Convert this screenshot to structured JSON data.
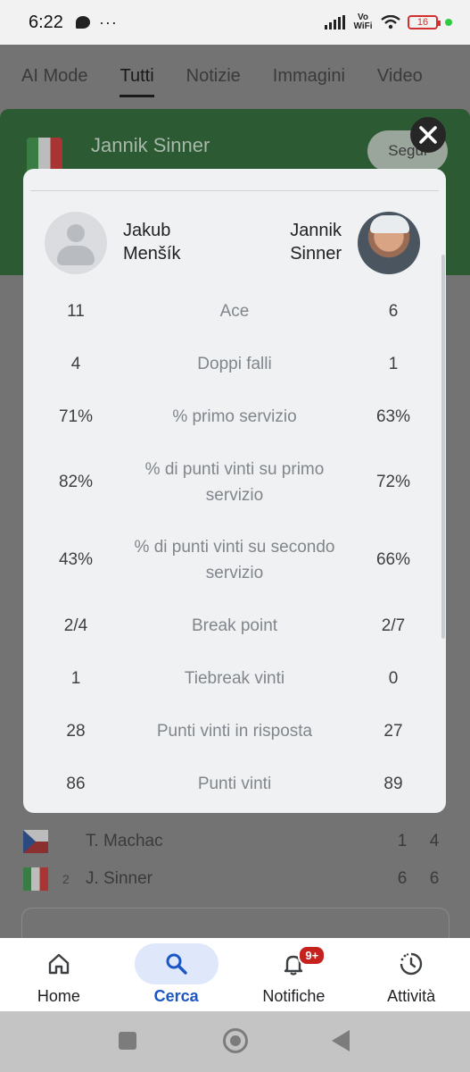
{
  "status_bar": {
    "time": "6:22",
    "dots": "···",
    "network": "Vo WiFi",
    "battery": "16"
  },
  "background": {
    "tabs": [
      "AI Mode",
      "Tutti",
      "Notizie",
      "Immagini",
      "Video"
    ],
    "active_tab": "Tutti",
    "hero": {
      "name": "Jannik Sinner",
      "follow_label": "Segui"
    },
    "match_rows": [
      {
        "seed": "",
        "player": "T. Machac",
        "set1": "1",
        "set2": "4"
      },
      {
        "seed": "2",
        "player": "J. Sinner",
        "set1": "6",
        "set2": "6"
      }
    ]
  },
  "modal": {
    "player1": {
      "first": "Jakub",
      "last": "Menšík"
    },
    "player2": {
      "first": "Jannik",
      "last": "Sinner"
    },
    "stats": [
      {
        "label": "Ace",
        "p1": "11",
        "p2": "6"
      },
      {
        "label": "Doppi falli",
        "p1": "4",
        "p2": "1"
      },
      {
        "label": "% primo servizio",
        "p1": "71%",
        "p2": "63%"
      },
      {
        "label": "% di punti vinti su primo servizio",
        "p1": "82%",
        "p2": "72%"
      },
      {
        "label": "% di punti vinti su secondo servizio",
        "p1": "43%",
        "p2": "66%"
      },
      {
        "label": "Break point",
        "p1": "2/4",
        "p2": "2/7"
      },
      {
        "label": "Tiebreak vinti",
        "p1": "1",
        "p2": "0"
      },
      {
        "label": "Punti vinti in risposta",
        "p1": "28",
        "p2": "27"
      },
      {
        "label": "Punti vinti",
        "p1": "86",
        "p2": "89"
      }
    ]
  },
  "bottom_nav": {
    "items": [
      {
        "label": "Home",
        "icon": "home-icon"
      },
      {
        "label": "Cerca",
        "icon": "search-icon"
      },
      {
        "label": "Notifiche",
        "icon": "bell-icon",
        "badge": "9+"
      },
      {
        "label": "Attività",
        "icon": "activity-icon"
      }
    ],
    "active": "Cerca"
  },
  "colors": {
    "accent": "#1a56c4",
    "badge": "#c5221f",
    "hero_bg": "#2b5a33"
  }
}
